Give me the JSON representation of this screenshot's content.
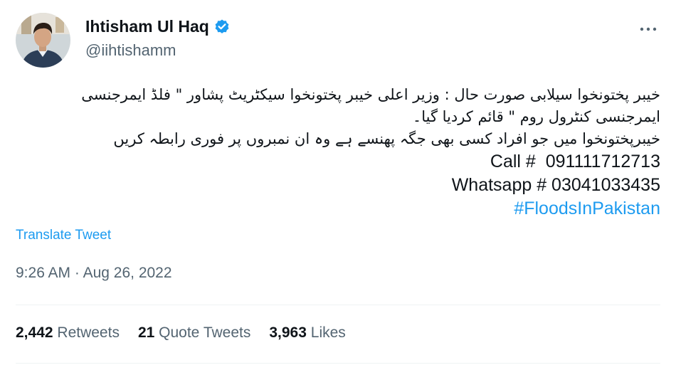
{
  "author": {
    "display_name": "Ihtisham Ul Haq",
    "handle": "@iihtishamm",
    "verified": true,
    "avatar_icon": "profile-photo"
  },
  "menu_icon": "more-horizontal-icon",
  "tweet": {
    "lines": [
      "خیبر پختونخوا سیلابی صورت حال : وزیر اعلی خیبر پختونخوا سیکٹریٹ پشاور \" فلڈ ایمرجنسی",
      "ایمرجنسی کنٹرول روم \" قائم کردیا گیا۔",
      "خیبرپختونخوا میں جو افراد کسی بھی جگہ پھنسے ہے وہ ان نمبروں پر فوری رابطہ کریں"
    ],
    "call_line": "Call #  091111712713",
    "whatsapp_line": "Whatsapp # 03041033435",
    "hashtag": "#FloodsInPakistan"
  },
  "translate_label": "Translate Tweet",
  "time": "9:26 AM",
  "separator": "·",
  "date": "Aug 26, 2022",
  "stats": {
    "retweets": {
      "count": "2,442",
      "label": "Retweets"
    },
    "quotes": {
      "count": "21",
      "label": "Quote Tweets"
    },
    "likes": {
      "count": "3,963",
      "label": "Likes"
    }
  },
  "colors": {
    "link": "#1d9bf0",
    "secondary_text": "#536471",
    "primary_text": "#0f1419",
    "divider": "#eff3f4"
  }
}
